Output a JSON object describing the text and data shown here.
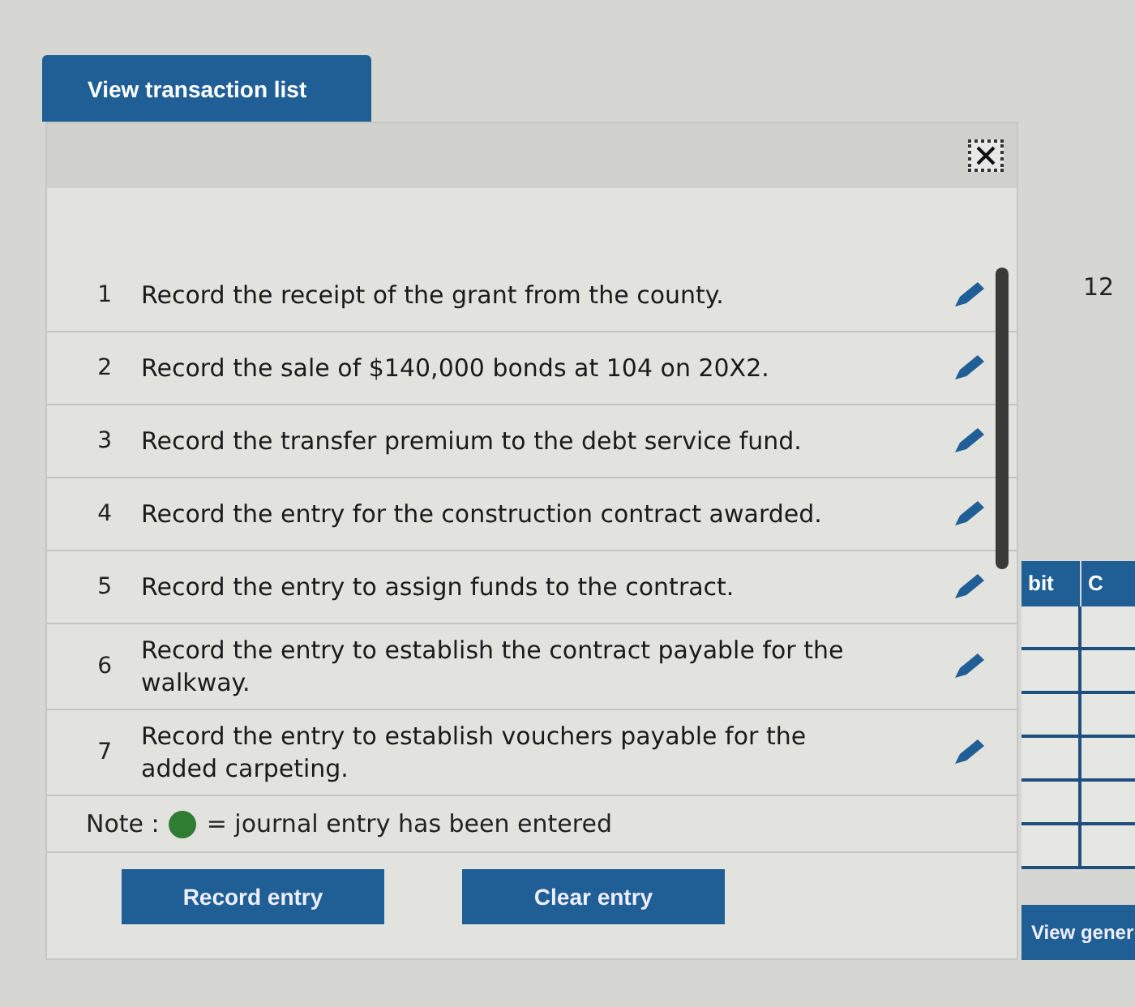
{
  "top_button": "View transaction list",
  "transactions": [
    {
      "number": "1",
      "text": "Record the receipt of the grant from the county."
    },
    {
      "number": "2",
      "text": "Record the sale of $140,000 bonds at 104 on 20X2."
    },
    {
      "number": "3",
      "text": "Record the transfer premium to the debt service fund."
    },
    {
      "number": "4",
      "text": "Record the entry for the construction contract awarded."
    },
    {
      "number": "5",
      "text": "Record the entry to assign funds to the contract."
    },
    {
      "number": "6",
      "text": "Record the entry to establish the contract payable for the walkway."
    },
    {
      "number": "7",
      "text": "Record the entry to establish vouchers payable for the added carpeting."
    }
  ],
  "note": {
    "label": "Note :",
    "color": "#2e7d32",
    "text": "= journal entry has been entered"
  },
  "buttons": [
    "Record entry",
    "Clear entry"
  ],
  "side_panel": {
    "number": "12",
    "columns": [
      "bit",
      "C"
    ],
    "button": "View gener"
  }
}
